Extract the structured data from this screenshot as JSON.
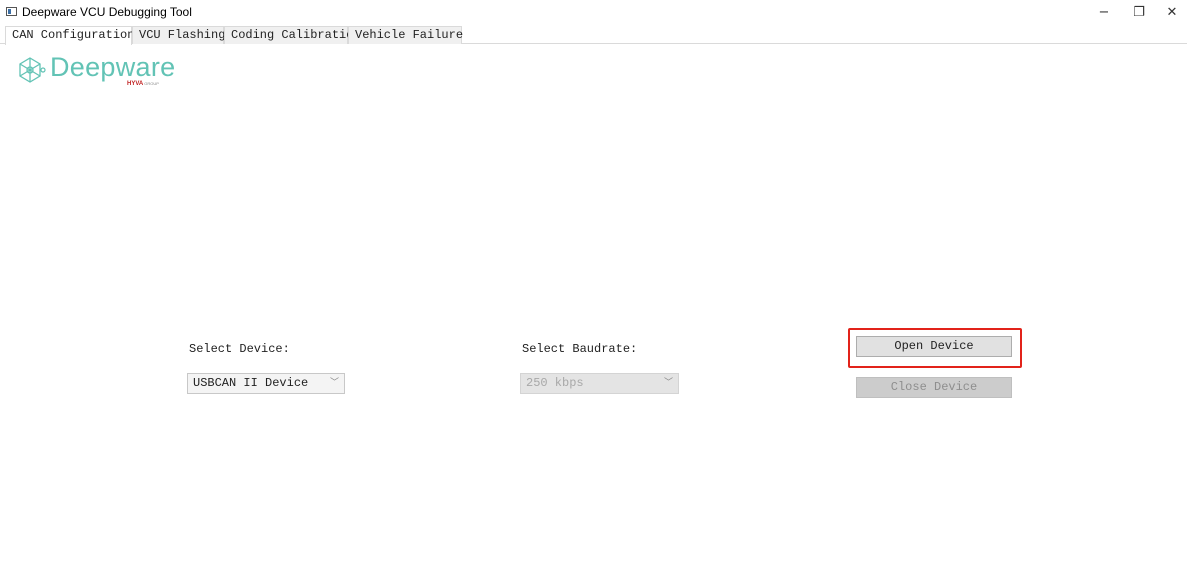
{
  "window": {
    "title": "Deepware VCU Debugging Tool",
    "minimize_glyph": "−",
    "restore_glyph": "❐",
    "close_glyph": "✕"
  },
  "tabs": [
    {
      "label": "CAN Configuration",
      "active": true
    },
    {
      "label": "VCU Flashing",
      "active": false
    },
    {
      "label": "Coding Calibration",
      "active": false
    },
    {
      "label": "Vehicle Failure",
      "active": false
    }
  ],
  "logo": {
    "brand": "Deepware",
    "sub_brand": "HYVA",
    "sub_group": "GROUP",
    "icon": "network-nodes-icon",
    "color": "#62c3b5"
  },
  "form": {
    "device_label": "Select Device:",
    "device_value": "USBCAN II Device",
    "baudrate_label": "Select Baudrate:",
    "baudrate_value": "250 kbps",
    "open_button": "Open Device",
    "close_button": "Close Device"
  },
  "colors": {
    "highlight": "#e2231a",
    "disabled_bg": "#cccccc"
  }
}
